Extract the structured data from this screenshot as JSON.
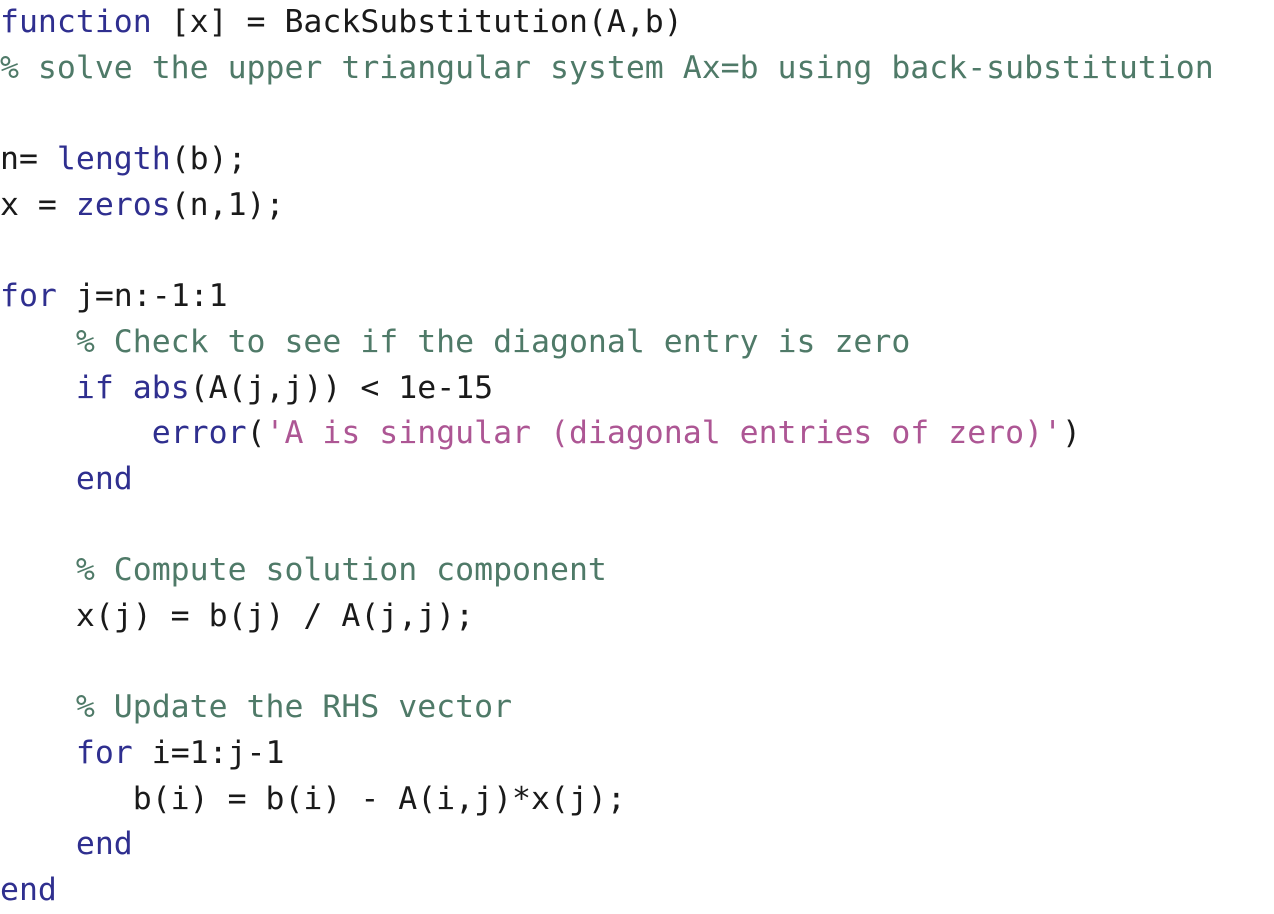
{
  "document": {
    "language": "MATLAB",
    "function_name": "BackSubstitution",
    "background_color": "#ffffff",
    "font_size_px": 31.5,
    "line_height_px": 45.7
  },
  "theme": {
    "keyword_color": "#2f2f8f",
    "builtin_color": "#2f2f8f",
    "comment_color": "#4f7a68",
    "string_color": "#ad5694",
    "plain_color": "#1a1a1a",
    "background_color": "#ffffff"
  },
  "code": {
    "plain_text": "function [x] = BackSubstitution(A,b)\n% solve the upper triangular system Ax=b using back-substitution\n\nn= length(b);\nx = zeros(n,1);\n\nfor j=n:-1:1\n    % Check to see if the diagonal entry is zero\n    if abs(A(j,j)) < 1e-15\n        error('A is singular (diagonal entries of zero)')\n    end\n\n    % Compute solution component\n    x(j) = b(j) / A(j,j);\n\n    % Update the RHS vector\n    for i=1:j-1\n       b(i) = b(i) - A(i,j)*x(j);\n    end\nend",
    "lines": [
      {
        "number": 1,
        "tokens": [
          {
            "text": "function",
            "type": "keyword"
          },
          {
            "text": " [x] = BackSubstitution(A,b)",
            "type": "plain"
          }
        ]
      },
      {
        "number": 2,
        "tokens": [
          {
            "text": "% solve the upper triangular system Ax=b using back-substitution",
            "type": "comment"
          }
        ]
      },
      {
        "number": 3,
        "tokens": []
      },
      {
        "number": 4,
        "tokens": [
          {
            "text": "n= ",
            "type": "plain"
          },
          {
            "text": "length",
            "type": "builtin"
          },
          {
            "text": "(b);",
            "type": "plain"
          }
        ]
      },
      {
        "number": 5,
        "tokens": [
          {
            "text": "x = ",
            "type": "plain"
          },
          {
            "text": "zeros",
            "type": "builtin"
          },
          {
            "text": "(n,1);",
            "type": "plain"
          }
        ]
      },
      {
        "number": 6,
        "tokens": []
      },
      {
        "number": 7,
        "tokens": [
          {
            "text": "for",
            "type": "keyword"
          },
          {
            "text": " j=n:-1:1",
            "type": "plain"
          }
        ]
      },
      {
        "number": 8,
        "tokens": [
          {
            "text": "    % Check to see if the diagonal entry is zero",
            "type": "comment"
          }
        ]
      },
      {
        "number": 9,
        "tokens": [
          {
            "text": "    ",
            "type": "plain"
          },
          {
            "text": "if",
            "type": "keyword"
          },
          {
            "text": " ",
            "type": "plain"
          },
          {
            "text": "abs",
            "type": "builtin"
          },
          {
            "text": "(A(j,j)) < 1e-15",
            "type": "plain"
          }
        ]
      },
      {
        "number": 10,
        "tokens": [
          {
            "text": "        ",
            "type": "plain"
          },
          {
            "text": "error",
            "type": "builtin"
          },
          {
            "text": "(",
            "type": "plain"
          },
          {
            "text": "'A is singular (diagonal entries of zero)'",
            "type": "string"
          },
          {
            "text": ")",
            "type": "plain"
          }
        ]
      },
      {
        "number": 11,
        "tokens": [
          {
            "text": "    ",
            "type": "plain"
          },
          {
            "text": "end",
            "type": "keyword"
          }
        ]
      },
      {
        "number": 12,
        "tokens": []
      },
      {
        "number": 13,
        "tokens": [
          {
            "text": "    % Compute solution component",
            "type": "comment"
          }
        ]
      },
      {
        "number": 14,
        "tokens": [
          {
            "text": "    x(j) = b(j) / A(j,j);",
            "type": "plain"
          }
        ]
      },
      {
        "number": 15,
        "tokens": []
      },
      {
        "number": 16,
        "tokens": [
          {
            "text": "    % Update the RHS vector",
            "type": "comment"
          }
        ]
      },
      {
        "number": 17,
        "tokens": [
          {
            "text": "    ",
            "type": "plain"
          },
          {
            "text": "for",
            "type": "keyword"
          },
          {
            "text": " i=1:j-1",
            "type": "plain"
          }
        ]
      },
      {
        "number": 18,
        "tokens": [
          {
            "text": "       b(i) = b(i) - A(i,j)*x(j);",
            "type": "plain"
          }
        ]
      },
      {
        "number": 19,
        "tokens": [
          {
            "text": "    ",
            "type": "plain"
          },
          {
            "text": "end",
            "type": "keyword"
          }
        ]
      },
      {
        "number": 20,
        "tokens": [
          {
            "text": "end",
            "type": "keyword"
          }
        ]
      }
    ]
  }
}
